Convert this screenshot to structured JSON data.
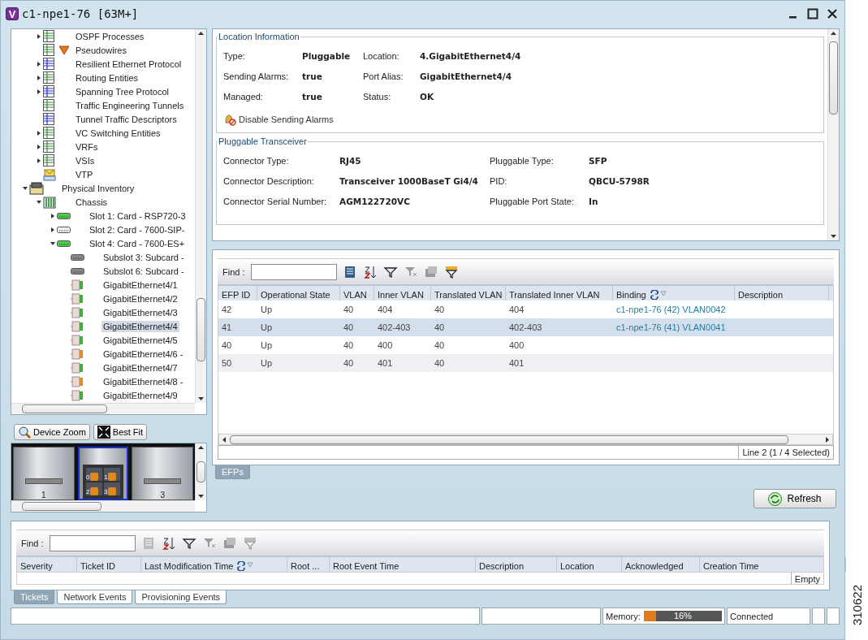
{
  "window": {
    "logo": "V",
    "title": "c1-npe1-76 [63M+]"
  },
  "tree": {
    "continued_children": [
      {
        "label": "OSPF Processes",
        "kind": "table",
        "expanded": false
      },
      {
        "label": "Pseudowires",
        "kind": "table",
        "alarm": true
      },
      {
        "label": "Resilient Ethernet Protocol",
        "kind": "table-blue",
        "expanded": false
      },
      {
        "label": "Routing Entities",
        "kind": "table",
        "expanded": false
      },
      {
        "label": "Spanning Tree Protocol",
        "kind": "table-blue",
        "expanded": false
      },
      {
        "label": "Traffic Engineering Tunnels",
        "kind": "table"
      },
      {
        "label": "Tunnel Traffic Descriptors",
        "kind": "table-blue"
      },
      {
        "label": "VC Switching Entities",
        "kind": "table",
        "expanded": false
      },
      {
        "label": "VRFs",
        "kind": "table",
        "expanded": false
      },
      {
        "label": "VSIs",
        "kind": "table",
        "expanded": false
      },
      {
        "label": "VTP",
        "kind": "envelope"
      }
    ],
    "nodes": [
      {
        "label": "Physical Inventory",
        "kind": "inventory",
        "expanded": true,
        "children": [
          {
            "label": "Chassis",
            "kind": "chassis",
            "expanded": true,
            "children": [
              {
                "label": "Slot 1: Card - RSP720-3",
                "kind": "card-green",
                "expanded": false
              },
              {
                "label": "Slot 2: Card - 7600-SIP-",
                "kind": "card-white",
                "expanded": false
              },
              {
                "label": "Slot 4: Card - 7600-ES+",
                "kind": "card-green",
                "expanded": true,
                "children": [
                  {
                    "label": "Subslot 3: Subcard -",
                    "kind": "subcard",
                    "selected": false
                  },
                  {
                    "label": "Subslot 6: Subcard -",
                    "kind": "subcard",
                    "selected": false
                  },
                  {
                    "label": "GigabitEthernet4/1",
                    "kind": "port-green",
                    "selected": false
                  },
                  {
                    "label": "GigabitEthernet4/2",
                    "kind": "port-green",
                    "selected": false
                  },
                  {
                    "label": "GigabitEthernet4/3",
                    "kind": "port-green",
                    "selected": false
                  },
                  {
                    "label": "GigabitEthernet4/4",
                    "kind": "port-green",
                    "selected": true
                  },
                  {
                    "label": "GigabitEthernet4/5",
                    "kind": "port-green",
                    "selected": false
                  },
                  {
                    "label": "GigabitEthernet4/6 -",
                    "kind": "port-orange",
                    "selected": false
                  },
                  {
                    "label": "GigabitEthernet4/7",
                    "kind": "port-green",
                    "selected": false
                  },
                  {
                    "label": "GigabitEthernet4/8 -",
                    "kind": "port-orange",
                    "selected": false
                  },
                  {
                    "label": "GigabitEthernet4/9",
                    "kind": "port-green",
                    "selected": false
                  }
                ]
              }
            ]
          }
        ]
      }
    ]
  },
  "device_view": {
    "buttons": [
      {
        "label": "Device Zoom",
        "kind": "zoom"
      },
      {
        "label": "Best Fit",
        "kind": "fit"
      }
    ],
    "slots": [
      {
        "kind": "blank",
        "label": "1",
        "selected": false
      },
      {
        "kind": "ports",
        "ports": [
          "0",
          "1",
          "2",
          "3"
        ],
        "selected": true
      },
      {
        "kind": "blank",
        "label": "3",
        "selected": false
      }
    ]
  },
  "location_information": {
    "title": "Location Information",
    "fields": [
      {
        "label": "Type:",
        "value": "Pluggable"
      },
      {
        "label": "Location:",
        "value": "4.GigabitEthernet4/4"
      },
      {
        "label": "Sending Alarms:",
        "value": "true"
      },
      {
        "label": "Port Alias:",
        "value": "GigabitEthernet4/4"
      },
      {
        "label": "Managed:",
        "value": "true"
      },
      {
        "label": "Status:",
        "value": "OK"
      }
    ],
    "action": "Disable Sending Alarms"
  },
  "pluggable_transceiver": {
    "title": "Pluggable Transceiver",
    "fields": [
      {
        "label": "Connector Type:",
        "value": "RJ45"
      },
      {
        "label": "Pluggable Type:",
        "value": "SFP"
      },
      {
        "label": "Connector Description:",
        "value": "Transceiver 1000BaseT Gi4/4"
      },
      {
        "label": "PID:",
        "value": "QBCU-5798R"
      },
      {
        "label": "Connector Serial Number:",
        "value": "AGM122720VC"
      },
      {
        "label": "Pluggable Port State:",
        "value": "In"
      }
    ]
  },
  "efp_table": {
    "find_label": "Find :",
    "toolbar": [
      {
        "kind": "export",
        "disabled": false
      },
      {
        "kind": "sort",
        "disabled": false
      },
      {
        "kind": "filter",
        "disabled": false
      },
      {
        "kind": "filter-clear",
        "disabled": true
      },
      {
        "kind": "columns",
        "disabled": true
      },
      {
        "kind": "filter-table",
        "disabled": false
      }
    ],
    "columns": [
      "EFP ID",
      "Operational State",
      "VLAN",
      "Inner VLAN",
      "Translated VLAN",
      "Translated Inner VLAN",
      "Binding",
      "Description"
    ],
    "rows": [
      {
        "cells": [
          "42",
          "Up",
          "40",
          "404",
          "40",
          "404",
          "c1-npe1-76 (42) VLAN0042",
          ""
        ],
        "selected": false
      },
      {
        "cells": [
          "41",
          "Up",
          "40",
          "402-403",
          "40",
          "402-403",
          "c1-npe1-76 (41) VLAN0041",
          ""
        ],
        "selected": true
      },
      {
        "cells": [
          "40",
          "Up",
          "40",
          "400",
          "40",
          "400",
          "",
          ""
        ],
        "selected": false
      },
      {
        "cells": [
          "50",
          "Up",
          "40",
          "401",
          "40",
          "401",
          "",
          ""
        ],
        "selected": false
      }
    ],
    "status": "Line 2 (1 / 4 Selected)"
  },
  "efp_tabs": [
    {
      "label": "EFPs",
      "selected": true
    }
  ],
  "refresh_button": "Refresh",
  "tickets_table": {
    "find_label": "Find :",
    "toolbar": [
      {
        "kind": "export",
        "disabled": true
      },
      {
        "kind": "sort",
        "disabled": false
      },
      {
        "kind": "filter",
        "disabled": false
      },
      {
        "kind": "filter-clear",
        "disabled": true
      },
      {
        "kind": "columns",
        "disabled": true
      },
      {
        "kind": "filter-table",
        "disabled": true
      }
    ],
    "columns": [
      "Severity",
      "Ticket ID",
      "Last Modification Time",
      "Root ...",
      "Root Event Time",
      "Description",
      "Location",
      "Acknowledged",
      "Creation Time"
    ],
    "status": "Empty"
  },
  "bottom_tabs": [
    {
      "label": "Tickets",
      "selected": true
    },
    {
      "label": "Network Events",
      "selected": false
    },
    {
      "label": "Provisioning Events",
      "selected": false
    }
  ],
  "status_bar": {
    "memory_label": "Memory:",
    "memory": {
      "level": 0.16,
      "reading": "16%"
    },
    "connection": "Connected"
  },
  "figure_number": "310622"
}
